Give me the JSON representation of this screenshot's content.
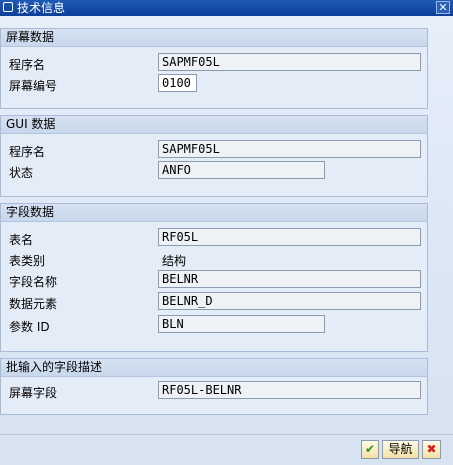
{
  "window": {
    "title": "技术信息",
    "close_glyph": "✕"
  },
  "sections": {
    "screen_data": {
      "header": "屏幕数据",
      "program_label": "程序名",
      "program_value": "SAPMF05L",
      "screen_no_label": "屏幕编号",
      "screen_no_value": "0100"
    },
    "gui_data": {
      "header": "GUI 数据",
      "program_label": "程序名",
      "program_value": "SAPMF05L",
      "status_label": "状态",
      "status_value": "ANFO"
    },
    "field_data": {
      "header": "字段数据",
      "table_label": "表名",
      "table_value": "RF05L",
      "table_type_label": "表类别",
      "table_type_value": "结构",
      "field_name_label": "字段名称",
      "field_name_value": "BELNR",
      "data_element_label": "数据元素",
      "data_element_value": "BELNR_D",
      "param_id_label": "参数 ID",
      "param_id_value": "BLN"
    },
    "batch_input": {
      "header": "批输入的字段描述",
      "screen_field_label": "屏幕字段",
      "screen_field_value": "RF05L-BELNR"
    }
  },
  "buttons": {
    "ok_glyph": "✔",
    "navigate_label": "导航",
    "cancel_glyph": "✖"
  },
  "colors": {
    "titlebar": "#0b3f99",
    "ok": "#2f8f1f",
    "cancel": "#d42020"
  }
}
